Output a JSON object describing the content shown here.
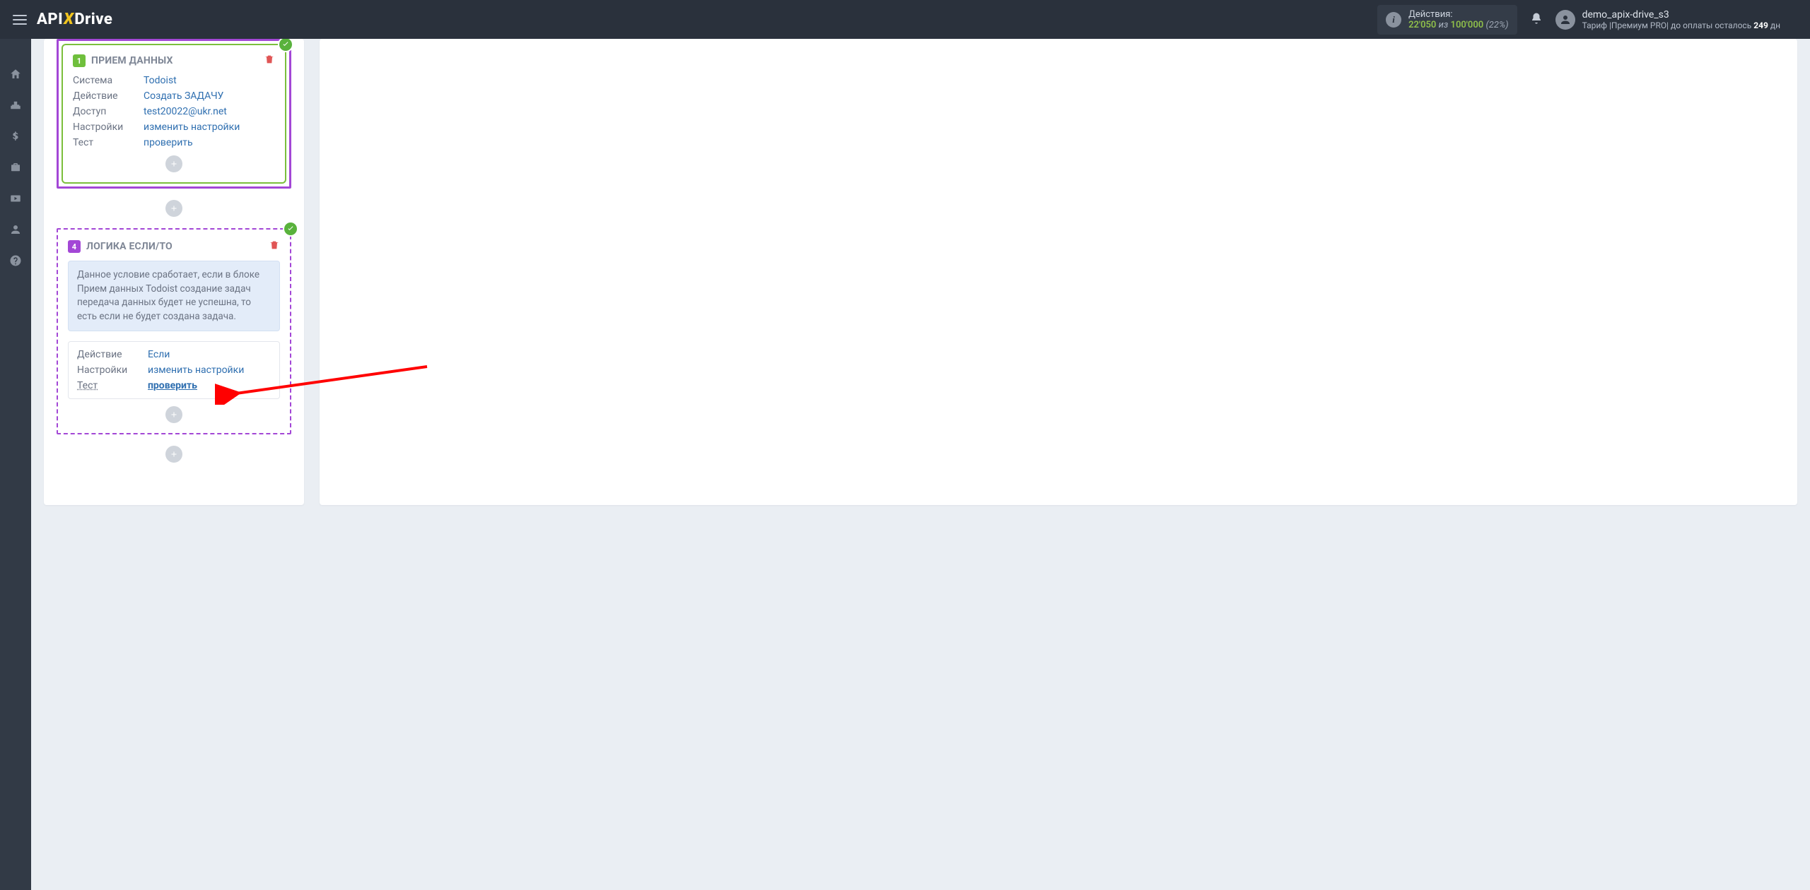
{
  "header": {
    "logo_pre": "API",
    "logo_x": "X",
    "logo_post": "Drive",
    "actions_label": "Действия:",
    "actions_used": "22'050",
    "actions_of": "из",
    "actions_total": "100'000",
    "actions_pct": "(22%)",
    "username": "demo_apix-drive_s3",
    "tariff_prefix": "Тариф |Премиум PRO| до оплаты осталось ",
    "tariff_days": "249",
    "tariff_suffix": " дн"
  },
  "block1": {
    "title": "ПРИЕМ ДАННЫХ",
    "step": "1",
    "rows": {
      "sys_k": "Система",
      "sys_v": "Todoist",
      "act_k": "Действие",
      "act_v": "Создать ЗАДАЧУ",
      "acc_k": "Доступ",
      "acc_v": "test20022@ukr.net",
      "set_k": "Настройки",
      "set_v": "изменить настройки",
      "tst_k": "Тест",
      "tst_v": "проверить"
    }
  },
  "block4": {
    "title": "ЛОГИКА ЕСЛИ/ТО",
    "step": "4",
    "info": "Данное условие сработает, если в блоке Прием данных Todoist создание задач передача данных будет не успешна, то есть если не будет создана задача.",
    "rows": {
      "act_k": "Действие",
      "act_v": "Если",
      "set_k": "Настройки",
      "set_v": "изменить настройки",
      "tst_k": "Тест",
      "tst_v": "проверить"
    }
  }
}
